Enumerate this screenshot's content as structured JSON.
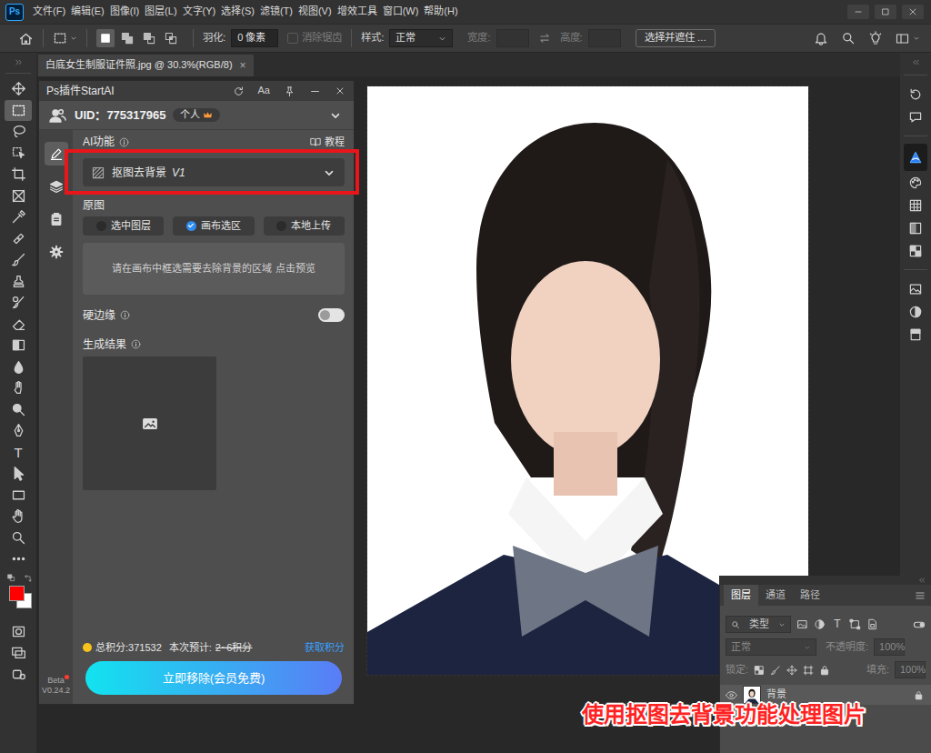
{
  "menubar": {
    "logo": "Ps",
    "menus": [
      "文件(F)",
      "编辑(E)",
      "图像(I)",
      "图层(L)",
      "文字(Y)",
      "选择(S)",
      "滤镜(T)",
      "视图(V)",
      "增效工具",
      "窗口(W)",
      "帮助(H)"
    ]
  },
  "options_bar": {
    "marquee_modes": [
      {
        "selected": true
      },
      {
        "selected": false
      },
      {
        "selected": false
      },
      {
        "selected": false
      }
    ],
    "feather_label": "羽化:",
    "feather_value": "0 像素",
    "antialias": {
      "label": "消除锯齿",
      "checked": false,
      "disabled": true
    },
    "style_label": "样式:",
    "style_value": "正常",
    "width": {
      "label": "宽度:",
      "disabled": true
    },
    "height": {
      "label": "高度:",
      "disabled": true
    },
    "select_mask_button": "选择并遮住 ..."
  },
  "document_tab": {
    "title": "白底女生制服证件照.jpg @ 30.3%(RGB/8)",
    "close": "×",
    "selected": true
  },
  "toolbar": {
    "tools": [
      {
        "kind": "move",
        "selected": false
      },
      {
        "kind": "marquee",
        "selected": true
      },
      {
        "kind": "lasso",
        "selected": false
      },
      {
        "kind": "object-select",
        "selected": false
      },
      {
        "kind": "crop",
        "selected": false
      },
      {
        "kind": "frame",
        "selected": false
      },
      {
        "kind": "eyedropper",
        "selected": false
      },
      {
        "kind": "healing",
        "selected": false
      },
      {
        "kind": "brush",
        "selected": false
      },
      {
        "kind": "stamp",
        "selected": false
      },
      {
        "kind": "history-brush",
        "selected": false
      },
      {
        "kind": "eraser",
        "selected": false
      },
      {
        "kind": "gradient",
        "selected": false
      },
      {
        "kind": "blur",
        "selected": false
      },
      {
        "kind": "smudge",
        "selected": false
      },
      {
        "kind": "dodge",
        "selected": false
      },
      {
        "kind": "pen",
        "selected": false
      },
      {
        "kind": "type",
        "selected": false,
        "glyph": "T"
      },
      {
        "kind": "path-select",
        "selected": false
      },
      {
        "kind": "rectangle",
        "selected": false
      },
      {
        "kind": "hand",
        "selected": false
      },
      {
        "kind": "zoom",
        "selected": false
      },
      {
        "kind": "more",
        "selected": false
      }
    ],
    "swatches": [
      {
        "kind": "foreground",
        "color": "#ff0000"
      },
      {
        "kind": "background",
        "color": "#ffffff"
      }
    ],
    "bottom_tools": [
      {
        "kind": "quick-mask"
      },
      {
        "kind": "screen-mode"
      },
      {
        "kind": "share"
      }
    ]
  },
  "canvas": {
    "selection": true
  },
  "plugin": {
    "title": "Ps插件StartAI",
    "font_button": "Aa",
    "uid": "UID：775317965",
    "plan_badge": "个人",
    "tabs": [
      {
        "kind": "edit",
        "selected": true
      },
      {
        "kind": "layers",
        "selected": false
      },
      {
        "kind": "doc",
        "selected": false
      },
      {
        "kind": "settings",
        "selected": false
      }
    ],
    "ai_label": "AI功能",
    "tutorial": "教程",
    "feature": {
      "label": "抠图去背景",
      "version": "V1",
      "highlighted": true
    },
    "source_label": "原图",
    "sources": [
      {
        "label": "选中图层",
        "selected": false
      },
      {
        "label": "画布选区",
        "selected": true
      },
      {
        "label": "本地上传",
        "selected": false
      }
    ],
    "hint": "请在画布中框选需要去除背景的区域 点击预览",
    "hard_edge": {
      "label": "硬边缘",
      "on": false
    },
    "result_label": "生成结果",
    "total_points": "总积分:371532",
    "estimate_label": "本次预计:",
    "estimate_value": "2~6积分",
    "estimate_struck": true,
    "get_points": "获取积分",
    "remove_button": "立即移除(会员免费)",
    "beta": "Beta",
    "beta_dot": true,
    "version": "V0.24.2"
  },
  "panel_strip": [
    {
      "kind": "history",
      "selected": false
    },
    {
      "kind": "comment",
      "selected": false
    },
    {
      "kind": "startai",
      "selected": true
    },
    {
      "kind": "color",
      "selected": false
    },
    {
      "kind": "swatchgrid",
      "selected": false
    },
    {
      "kind": "gradients",
      "selected": false
    },
    {
      "kind": "patterns",
      "selected": false
    },
    {
      "kind": "properties",
      "selected": false
    },
    {
      "kind": "adjust",
      "selected": false
    },
    {
      "kind": "libraries",
      "selected": false
    }
  ],
  "layers_panel": {
    "tabs": [
      {
        "label": "图层",
        "selected": true
      },
      {
        "label": "通道",
        "selected": false
      },
      {
        "label": "路径",
        "selected": false
      }
    ],
    "filter_value": "类型",
    "filter_icons": [
      {
        "kind": "pixel"
      },
      {
        "kind": "adjust"
      },
      {
        "kind": "type",
        "glyph": "T"
      },
      {
        "kind": "shape"
      },
      {
        "kind": "smart"
      }
    ],
    "blend_mode": "正常",
    "opacity_label": "不透明度:",
    "opacity_value": "100%",
    "lock_label": "锁定:",
    "fill_label": "填充:",
    "fill_value": "100%",
    "controls_disabled": true,
    "layers": [
      {
        "name": "背景",
        "visible": true,
        "locked": true
      }
    ]
  },
  "annotation": {
    "caption": "使用抠图去背景功能处理图片"
  }
}
